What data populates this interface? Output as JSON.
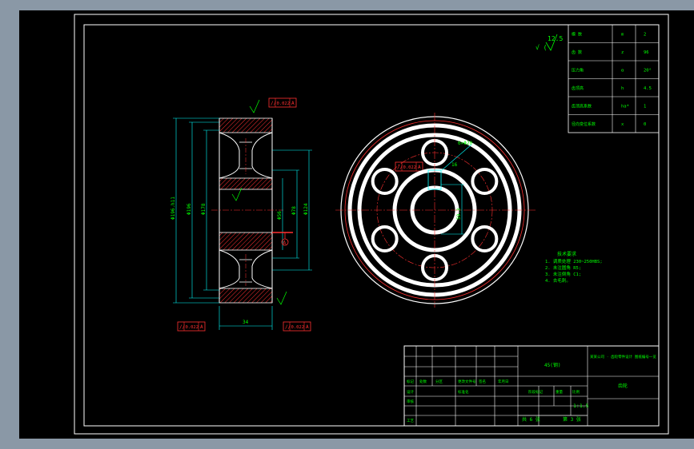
{
  "drawing": {
    "roughness_symbol": "12.5",
    "params": [
      {
        "name": "模 数",
        "sym": "m",
        "val": "2"
      },
      {
        "name": "齿 数",
        "sym": "z",
        "val": "96"
      },
      {
        "name": "压力角",
        "sym": "α",
        "val": "20°"
      },
      {
        "name": "齿顶高",
        "sym": "h",
        "val": "4.5"
      },
      {
        "name": "齿顶高系数",
        "sym": "ha*",
        "val": "1"
      },
      {
        "name": "径向变位系数",
        "sym": "x",
        "val": "0"
      }
    ],
    "tolerance_frames": [
      {
        "sym": "//",
        "val": "0.022",
        "datum": "A"
      },
      {
        "sym": "//",
        "val": "0.022",
        "datum": "A"
      },
      {
        "sym": "//",
        "val": "0.022",
        "datum": "A"
      },
      {
        "sym": "//",
        "val": "0.022",
        "datum": "A"
      }
    ],
    "section_dims": {
      "outer_dia": "Φ196.h11",
      "dia_2": "Φ196",
      "dia_3": "Φ178",
      "bore": "Φ56",
      "hub": "Φ78",
      "dim_124": "Φ124",
      "width": "34",
      "datum": "A"
    },
    "view_dims": {
      "keyway_width": "16",
      "keyway_depth": "59.3",
      "hole_note": "6×Φ20"
    },
    "tech_requirements": {
      "title": "技术要求",
      "items": [
        "1. 调质处理 230~250HBS;",
        "2. 未注圆角 R5;",
        "3. 未注倒角 C1;",
        "4. 去毛刺。"
      ]
    },
    "title_block": {
      "material": "45(钢)",
      "project": "某某公司 · 齿轮零件设计 图纸编号一览",
      "part_name": "齿轮",
      "scale": "1:1.5",
      "sheet_total": "共 6 张",
      "sheet_no": "第 3 张",
      "row_labels": [
        "标记",
        "处数",
        "分区",
        "更改文件号",
        "签名",
        "年月日"
      ],
      "roles": [
        "设计",
        "审核",
        "工艺"
      ],
      "std": "标准化",
      "stage": "阶段标记",
      "weight": "重量",
      "scale_label": "比例"
    }
  }
}
